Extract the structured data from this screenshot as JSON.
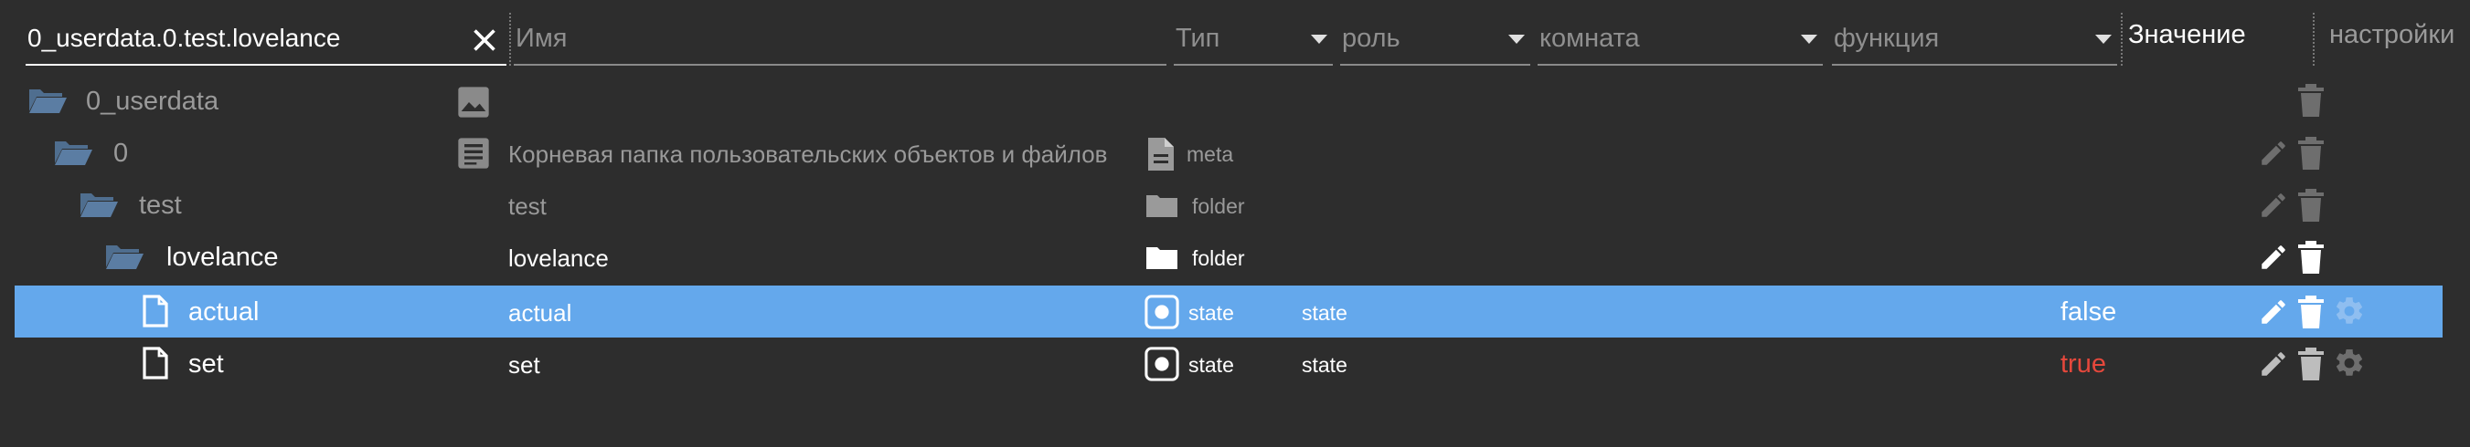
{
  "header": {
    "search_value": "0_userdata.0.test.lovelance",
    "name_placeholder": "Имя",
    "type_placeholder": "Тип",
    "role_placeholder": "роль",
    "room_placeholder": "комната",
    "function_placeholder": "функция",
    "value_label": "Значение",
    "settings_label": "настройки"
  },
  "rows": [
    {
      "name": "0_userdata",
      "description": "",
      "type": "",
      "role": "",
      "value": ""
    },
    {
      "name": "0",
      "description": "Корневая папка пользовательских объектов и файлов",
      "type": "meta",
      "role": "",
      "value": ""
    },
    {
      "name": "test",
      "description": "test",
      "type": "folder",
      "role": "",
      "value": ""
    },
    {
      "name": "lovelance",
      "description": "lovelance",
      "type": "folder",
      "role": "",
      "value": ""
    },
    {
      "name": "actual",
      "description": "actual",
      "type": "state",
      "role": "state",
      "value": "false"
    },
    {
      "name": "set",
      "description": "set",
      "type": "state",
      "role": "state",
      "value": "true"
    }
  ],
  "colors": {
    "background": "#2d2d2d",
    "selected_row": "#64a8ec",
    "folder_icon": "#4f6e8f",
    "value_true": "#e5483c"
  },
  "icons": [
    "close-icon",
    "chevron-down-icon",
    "folder-open-icon",
    "image-icon",
    "text-icon",
    "file-icon",
    "folder-icon",
    "state-icon",
    "pencil-icon",
    "trash-icon",
    "gear-icon"
  ]
}
